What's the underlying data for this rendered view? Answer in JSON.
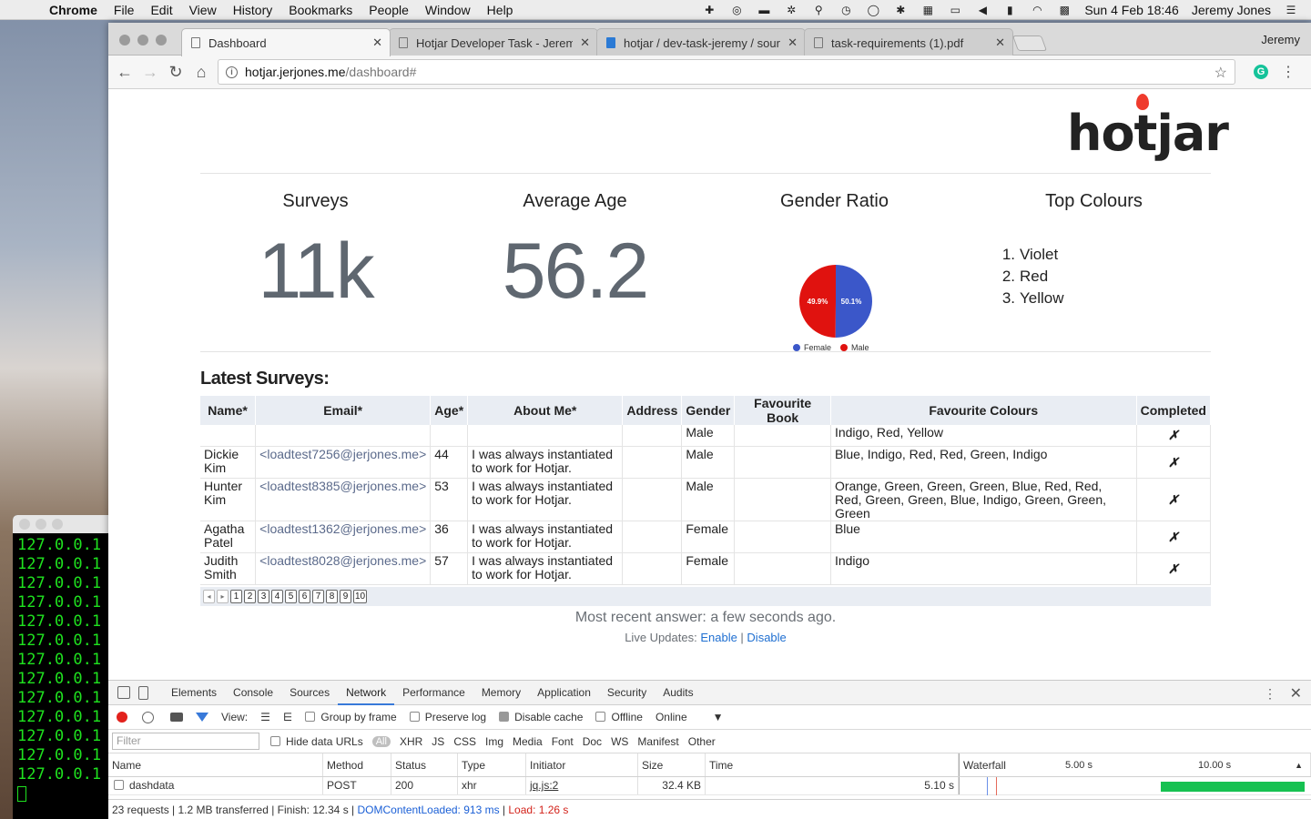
{
  "menubar": {
    "app": "Chrome",
    "items": [
      "File",
      "Edit",
      "View",
      "History",
      "Bookmarks",
      "People",
      "Window",
      "Help"
    ],
    "clock": "Sun 4 Feb  18:46",
    "user": "Jeremy Jones"
  },
  "terminal": {
    "lines": [
      "127.0.0.1",
      "127.0.0.1",
      "127.0.0.1",
      "127.0.0.1",
      "127.0.0.1",
      "127.0.0.1",
      "127.0.0.1",
      "127.0.0.1",
      "127.0.0.1",
      "127.0.0.1",
      "127.0.0.1",
      "127.0.0.1",
      "127.0.0.1"
    ]
  },
  "browser": {
    "tabs": [
      "Dashboard",
      "Hotjar Developer Task - Jerem",
      "hotjar / dev-task-jeremy / sour",
      "task-requirements (1).pdf"
    ],
    "profile": "Jeremy",
    "url_host": "hotjar.jerjones.me",
    "url_path": "/dashboard#"
  },
  "page": {
    "logo": "hotjar",
    "stats": {
      "surveys_label": "Surveys",
      "surveys_value": "11k",
      "age_label": "Average Age",
      "age_value": "56.2",
      "gender_label": "Gender Ratio",
      "colours_label": "Top Colours"
    },
    "gender": {
      "female_pct": "50.1%",
      "male_pct": "49.9%",
      "female_value": 50.1,
      "male_value": 49.9,
      "female_label": "Female",
      "male_label": "Male",
      "female_color": "#3b57c9",
      "male_color": "#e0120f"
    },
    "top_colours": [
      "Violet",
      "Red",
      "Yellow"
    ],
    "latest_title": "Latest Surveys:",
    "columns": [
      "Name*",
      "Email*",
      "Age*",
      "About Me*",
      "Address",
      "Gender",
      "Favourite Book",
      "Favourite Colours",
      "Completed"
    ],
    "rows": [
      {
        "name": "",
        "email": "",
        "age": "",
        "about": "",
        "address": "",
        "gender": "Male",
        "book": "",
        "colours": "Indigo, Red, Yellow",
        "completed": "✗"
      },
      {
        "name": "Dickie Kim",
        "email": "<loadtest7256@jerjones.me>",
        "age": "44",
        "about": "I was always instantiated to work for Hotjar.",
        "address": "",
        "gender": "Male",
        "book": "",
        "colours": "Blue, Indigo, Red, Red, Green, Indigo",
        "completed": "✗"
      },
      {
        "name": "Hunter Kim",
        "email": "<loadtest8385@jerjones.me>",
        "age": "53",
        "about": "I was always instantiated to work for Hotjar.",
        "address": "",
        "gender": "Male",
        "book": "",
        "colours": "Orange, Green, Green, Green, Blue, Red, Red, Red, Green, Green, Blue, Indigo, Green, Green, Green",
        "completed": "✗"
      },
      {
        "name": "Agatha Patel",
        "email": "<loadtest1362@jerjones.me>",
        "age": "36",
        "about": "I was always instantiated to work for Hotjar.",
        "address": "",
        "gender": "Female",
        "book": "",
        "colours": "Blue",
        "completed": "✗"
      },
      {
        "name": "Judith Smith",
        "email": "<loadtest8028@jerjones.me>",
        "age": "57",
        "about": "I was always instantiated to work for Hotjar.",
        "address": "",
        "gender": "Female",
        "book": "",
        "colours": "Indigo",
        "completed": "✗"
      }
    ],
    "pager": [
      "1",
      "2",
      "3",
      "4",
      "5",
      "6",
      "7",
      "8",
      "9",
      "10"
    ],
    "recent": "Most recent answer: a few seconds ago.",
    "live_label": "Live Updates:",
    "enable": "Enable",
    "disable": "Disable"
  },
  "devtools": {
    "tabs": [
      "Elements",
      "Console",
      "Sources",
      "Network",
      "Performance",
      "Memory",
      "Application",
      "Security",
      "Audits"
    ],
    "active_tab": "Network",
    "view_label": "View:",
    "group_by_frame": "Group by frame",
    "preserve_log": "Preserve log",
    "disable_cache": "Disable cache",
    "offline": "Offline",
    "throttle": "Online",
    "filter_placeholder": "Filter",
    "hide_data_urls": "Hide data URLs",
    "all": "All",
    "types": [
      "XHR",
      "JS",
      "CSS",
      "Img",
      "Media",
      "Font",
      "Doc",
      "WS",
      "Manifest",
      "Other"
    ],
    "headers": {
      "name": "Name",
      "method": "Method",
      "status": "Status",
      "type": "Type",
      "initiator": "Initiator",
      "size": "Size",
      "time": "Time",
      "waterfall": "Waterfall",
      "t5": "5.00 s",
      "t10": "10.00 s"
    },
    "request": {
      "name": "dashdata",
      "method": "POST",
      "status": "200",
      "type": "xhr",
      "initiator": "jq.js:2",
      "size": "32.4 KB",
      "time": "5.10 s"
    },
    "summary": "23 requests | 1.2 MB transferred | Finish: 12.34 s | ",
    "dom": "DOMContentLoaded: 913 ms",
    "sep": " | ",
    "load": "Load: 1.26 s"
  }
}
